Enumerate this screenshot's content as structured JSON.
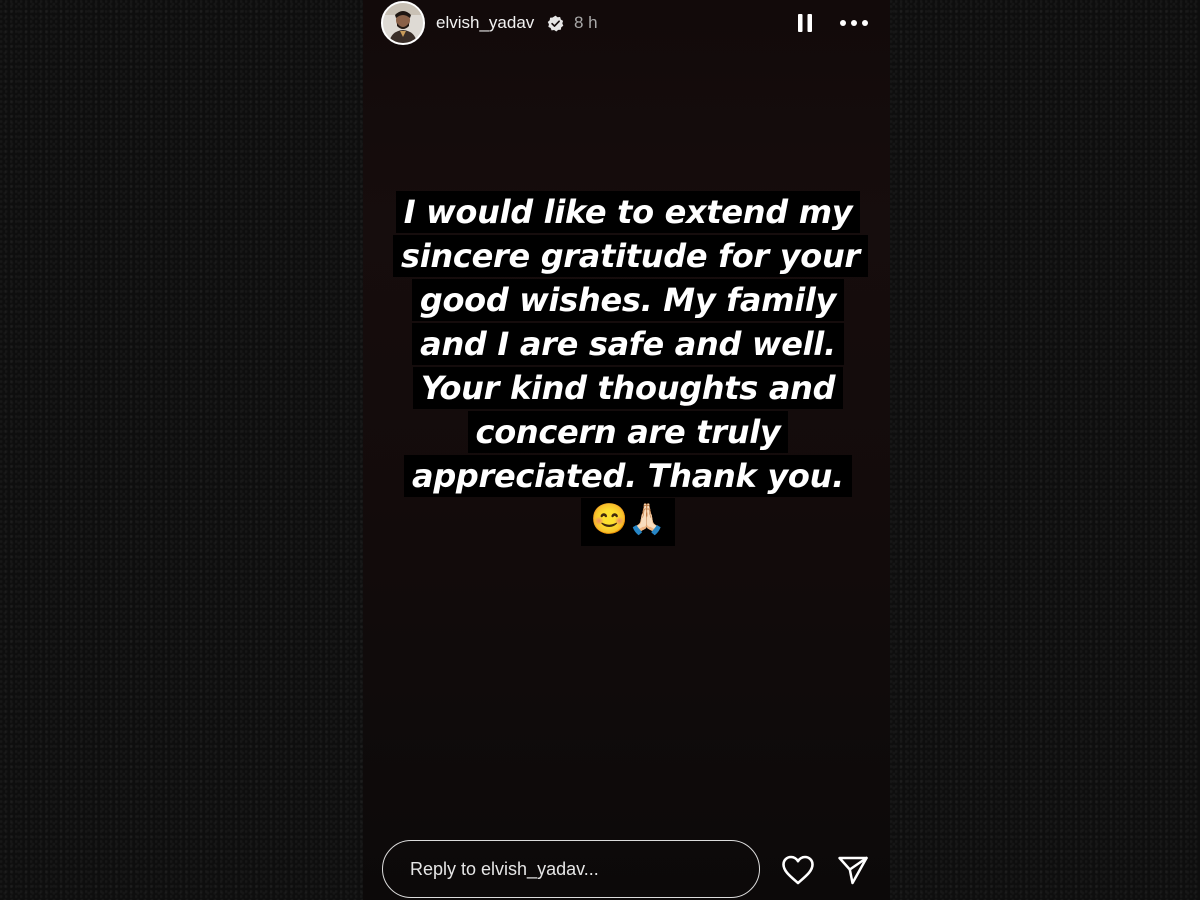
{
  "story": {
    "username": "elvish_yadav",
    "time": "8 h",
    "message": "I would like to extend my sincere gratitude for your good wishes. My family and I are safe and well. Your kind thoughts and concern are truly appreciated. Thank you.",
    "emojis": "😊🙏🏻"
  },
  "icons": {
    "verified": "verified-badge-icon",
    "pause": "pause-icon",
    "more": "more-options-icon",
    "heart": "heart-icon",
    "send": "send-icon"
  },
  "reply": {
    "placeholder": "Reply to elvish_yadav..."
  },
  "colors": {
    "background": "#0e0e0e",
    "story_background": "#140c0c",
    "text_highlight": "#000000",
    "text": "#ffffff"
  }
}
